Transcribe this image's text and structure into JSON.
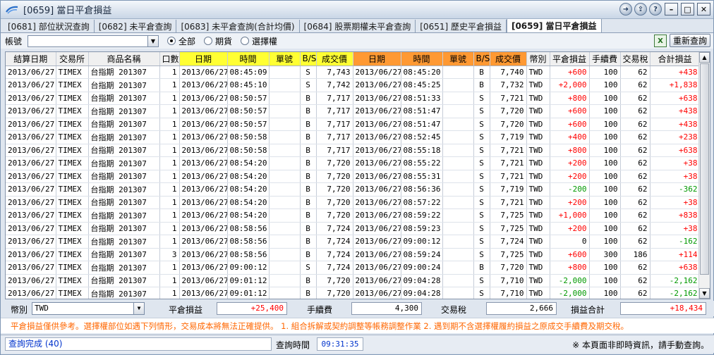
{
  "window": {
    "title": "[0659] 當日平倉損益"
  },
  "tabs": [
    {
      "label": "[0681] 部位狀況查詢",
      "active": false
    },
    {
      "label": "[0682] 未平倉查詢",
      "active": false
    },
    {
      "label": "[0683] 未平倉查詢(合計均價)",
      "active": false
    },
    {
      "label": "[0684] 股票期權未平倉查詢",
      "active": false
    },
    {
      "label": "[0651] 歷史平倉損益",
      "active": false
    },
    {
      "label": "[0659] 當日平倉損益",
      "active": true
    }
  ],
  "filter": {
    "account_label": "帳號",
    "account_value": "",
    "radio_all": "全部",
    "radio_futures": "期貨",
    "radio_options": "選擇權",
    "excel_icon": "excel-icon",
    "requery_label": "重新查詢"
  },
  "table": {
    "headers": [
      "結算日期",
      "交易所",
      "商品名稱",
      "口數",
      "日期",
      "時間",
      "單號",
      "B/S",
      "成交價",
      "日期",
      "時間",
      "單號",
      "B/S",
      "成交價",
      "幣別",
      "平倉損益",
      "手續費",
      "交易稅",
      "合計損益"
    ],
    "rows": [
      [
        "2013/06/27",
        "TIMEX",
        "台指期 201307",
        "1",
        "2013/06/27",
        "08:45:09",
        "",
        "S",
        "7,743",
        "2013/06/27",
        "08:45:20",
        "",
        "B",
        "7,740",
        "TWD",
        "+600",
        "100",
        "62",
        "+438"
      ],
      [
        "2013/06/27",
        "TIMEX",
        "台指期 201307",
        "1",
        "2013/06/27",
        "08:45:10",
        "",
        "S",
        "7,742",
        "2013/06/27",
        "08:45:25",
        "",
        "B",
        "7,732",
        "TWD",
        "+2,000",
        "100",
        "62",
        "+1,838"
      ],
      [
        "2013/06/27",
        "TIMEX",
        "台指期 201307",
        "1",
        "2013/06/27",
        "08:50:57",
        "",
        "B",
        "7,717",
        "2013/06/27",
        "08:51:33",
        "",
        "S",
        "7,721",
        "TWD",
        "+800",
        "100",
        "62",
        "+638"
      ],
      [
        "2013/06/27",
        "TIMEX",
        "台指期 201307",
        "1",
        "2013/06/27",
        "08:50:57",
        "",
        "B",
        "7,717",
        "2013/06/27",
        "08:51:47",
        "",
        "S",
        "7,720",
        "TWD",
        "+600",
        "100",
        "62",
        "+438"
      ],
      [
        "2013/06/27",
        "TIMEX",
        "台指期 201307",
        "1",
        "2013/06/27",
        "08:50:57",
        "",
        "B",
        "7,717",
        "2013/06/27",
        "08:51:47",
        "",
        "S",
        "7,720",
        "TWD",
        "+600",
        "100",
        "62",
        "+438"
      ],
      [
        "2013/06/27",
        "TIMEX",
        "台指期 201307",
        "1",
        "2013/06/27",
        "08:50:58",
        "",
        "B",
        "7,717",
        "2013/06/27",
        "08:52:45",
        "",
        "S",
        "7,719",
        "TWD",
        "+400",
        "100",
        "62",
        "+238"
      ],
      [
        "2013/06/27",
        "TIMEX",
        "台指期 201307",
        "1",
        "2013/06/27",
        "08:50:58",
        "",
        "B",
        "7,717",
        "2013/06/27",
        "08:55:18",
        "",
        "S",
        "7,721",
        "TWD",
        "+800",
        "100",
        "62",
        "+638"
      ],
      [
        "2013/06/27",
        "TIMEX",
        "台指期 201307",
        "1",
        "2013/06/27",
        "08:54:20",
        "",
        "B",
        "7,720",
        "2013/06/27",
        "08:55:22",
        "",
        "S",
        "7,721",
        "TWD",
        "+200",
        "100",
        "62",
        "+38"
      ],
      [
        "2013/06/27",
        "TIMEX",
        "台指期 201307",
        "1",
        "2013/06/27",
        "08:54:20",
        "",
        "B",
        "7,720",
        "2013/06/27",
        "08:55:31",
        "",
        "S",
        "7,721",
        "TWD",
        "+200",
        "100",
        "62",
        "+38"
      ],
      [
        "2013/06/27",
        "TIMEX",
        "台指期 201307",
        "1",
        "2013/06/27",
        "08:54:20",
        "",
        "B",
        "7,720",
        "2013/06/27",
        "08:56:36",
        "",
        "S",
        "7,719",
        "TWD",
        "-200",
        "100",
        "62",
        "-362"
      ],
      [
        "2013/06/27",
        "TIMEX",
        "台指期 201307",
        "1",
        "2013/06/27",
        "08:54:20",
        "",
        "B",
        "7,720",
        "2013/06/27",
        "08:57:22",
        "",
        "S",
        "7,721",
        "TWD",
        "+200",
        "100",
        "62",
        "+38"
      ],
      [
        "2013/06/27",
        "TIMEX",
        "台指期 201307",
        "1",
        "2013/06/27",
        "08:54:20",
        "",
        "B",
        "7,720",
        "2013/06/27",
        "08:59:22",
        "",
        "S",
        "7,725",
        "TWD",
        "+1,000",
        "100",
        "62",
        "+838"
      ],
      [
        "2013/06/27",
        "TIMEX",
        "台指期 201307",
        "1",
        "2013/06/27",
        "08:58:56",
        "",
        "B",
        "7,724",
        "2013/06/27",
        "08:59:23",
        "",
        "S",
        "7,725",
        "TWD",
        "+200",
        "100",
        "62",
        "+38"
      ],
      [
        "2013/06/27",
        "TIMEX",
        "台指期 201307",
        "1",
        "2013/06/27",
        "08:58:56",
        "",
        "B",
        "7,724",
        "2013/06/27",
        "09:00:12",
        "",
        "S",
        "7,724",
        "TWD",
        "0",
        "100",
        "62",
        "-162"
      ],
      [
        "2013/06/27",
        "TIMEX",
        "台指期 201307",
        "3",
        "2013/06/27",
        "08:58:56",
        "",
        "B",
        "7,724",
        "2013/06/27",
        "08:59:24",
        "",
        "S",
        "7,725",
        "TWD",
        "+600",
        "300",
        "186",
        "+114"
      ],
      [
        "2013/06/27",
        "TIMEX",
        "台指期 201307",
        "1",
        "2013/06/27",
        "09:00:12",
        "",
        "S",
        "7,724",
        "2013/06/27",
        "09:00:24",
        "",
        "B",
        "7,720",
        "TWD",
        "+800",
        "100",
        "62",
        "+638"
      ],
      [
        "2013/06/27",
        "TIMEX",
        "台指期 201307",
        "1",
        "2013/06/27",
        "09:01:12",
        "",
        "B",
        "7,720",
        "2013/06/27",
        "09:04:28",
        "",
        "S",
        "7,710",
        "TWD",
        "-2,000",
        "100",
        "62",
        "-2,162"
      ],
      [
        "2013/06/27",
        "TIMEX",
        "台指期 201307",
        "1",
        "2013/06/27",
        "09:01:12",
        "",
        "B",
        "7,720",
        "2013/06/27",
        "09:04:28",
        "",
        "S",
        "7,710",
        "TWD",
        "-2,000",
        "100",
        "62",
        "-2,162"
      ]
    ]
  },
  "summary": {
    "currency_label": "幣別",
    "currency_value": "TWD",
    "pnl_label": "平倉損益",
    "pnl_value": "+25,400",
    "fee_label": "手續費",
    "fee_value": "4,300",
    "tax_label": "交易稅",
    "tax_value": "2,666",
    "total_label": "損益合計",
    "total_value": "+18,434"
  },
  "notice": "平倉損益僅供參考。選擇權部位如遇下列情形，交易成本將無法正確提供。  1. 組合拆解或契約調整等帳務調整作業  2. 遇到期不含選擇權履約損益之原成交手續費及期交稅。",
  "status": {
    "left": "查詢完成 (40)",
    "query_time_label": "查詢時間",
    "query_time_value": "09:31:35",
    "right": "※ 本頁面非即時資訊，請手動查詢。"
  },
  "colors": {
    "positive": "#ff0000",
    "negative": "#009900",
    "header_yellow": "#ffff33",
    "header_orange": "#ff9933",
    "notice": "#ff6600"
  }
}
